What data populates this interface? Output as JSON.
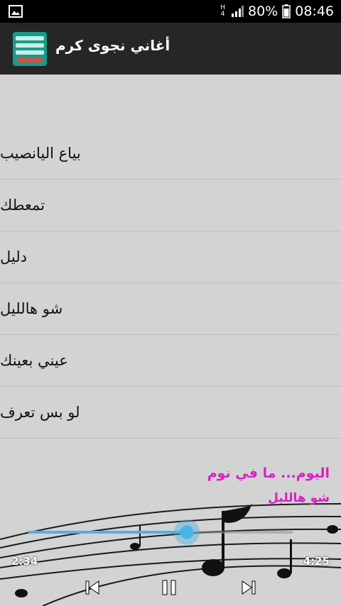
{
  "status_bar": {
    "network_type": "H",
    "battery_percent": "80%",
    "time": "08:46",
    "icons": [
      "gallery-icon",
      "network-type-icon",
      "signal-icon",
      "battery-icon"
    ]
  },
  "app_bar": {
    "title": "أغاني نجوى كرم",
    "icon": "app-logo-icon"
  },
  "songs": [
    {
      "label": "بياع اليانصيب"
    },
    {
      "label": "تمعطك"
    },
    {
      "label": "دليل"
    },
    {
      "label": "شو هالليل"
    },
    {
      "label": "عيني بعينك"
    },
    {
      "label": "لو بس تعرف"
    }
  ],
  "player": {
    "album": "اليوم... ما في نوم",
    "now_playing": "شو هالليل",
    "current_time": "2:34",
    "total_time": "4:25",
    "progress": 0.6,
    "controls": [
      "previous-icon",
      "pause-icon",
      "next-icon"
    ],
    "accent_color": "#4ab3e6",
    "text_color": "#d81fc8"
  }
}
